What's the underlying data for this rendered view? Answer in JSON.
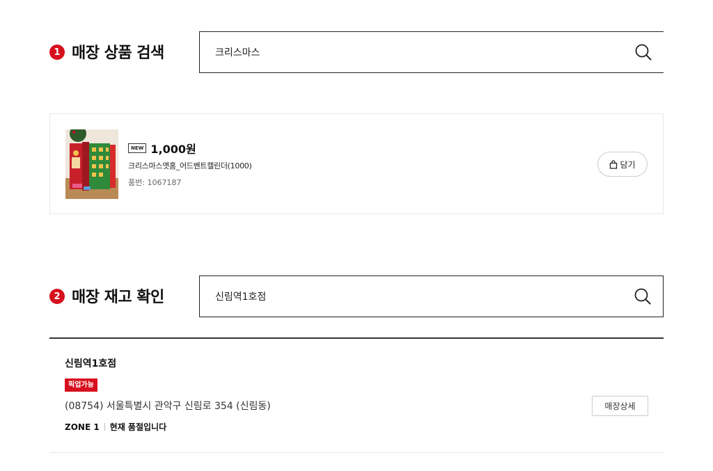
{
  "section1": {
    "number": "1",
    "title": "매장 상품 검색",
    "search_value": "크리스마스",
    "search_icon": "search-icon"
  },
  "product": {
    "badge": "NEW",
    "price": "1,000원",
    "name": "크리스마스앳홈_어드벤트캘린더(1000)",
    "code": "품번: 1067187",
    "cart_label": "담기",
    "cart_icon": "shopping-bag-icon"
  },
  "section2": {
    "number": "2",
    "title": "매장 재고 확인",
    "search_value": "신림역1호점",
    "search_icon": "search-icon"
  },
  "store": {
    "name": "신림역1호점",
    "pickup_badge": "픽업가능",
    "address": "(08754) 서울특별시 관악구 신림로 354 (신림동)",
    "zone": "ZONE 1",
    "stock_status": "현재 품절입니다",
    "detail_label": "매장상세"
  },
  "colors": {
    "accent": "#d7101e",
    "border_dark": "#222222"
  }
}
